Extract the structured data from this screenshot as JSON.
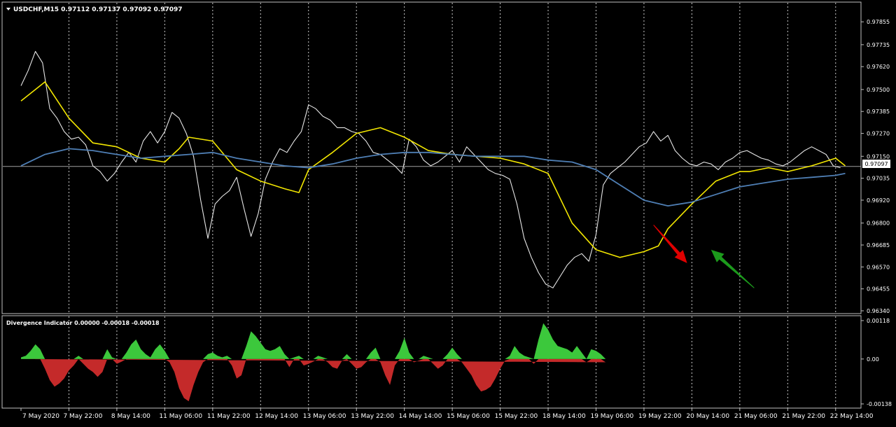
{
  "colors": {
    "background": "#000000",
    "frame": "#c0c0c0",
    "grid": "#c8c8c8",
    "price": "#e6e6e6",
    "ma_fast": "#f2e600",
    "ma_slow": "#4f7fb5",
    "bar_positive": "#3cc83c",
    "bar_negative": "#c42a2a",
    "arrow_down": "#e00000",
    "arrow_up": "#1c9a1c",
    "current_price_line": "#a0a0a0"
  },
  "main_chart": {
    "header": "USDCHF,M15  0.97112 0.97137 0.97092 0.97097",
    "current_price_label": "0.97097",
    "current_price": 0.97097
  },
  "indicator": {
    "header": "Divergence Indicator 0.00000 -0.00018 -0.00018"
  },
  "chart_data": [
    {
      "type": "line",
      "title": "USDCHF,M15",
      "ylim": [
        0.9634,
        0.9794
      ],
      "x_categories": [
        "7 May 2020",
        "7 May 22:00",
        "8 May 14:00",
        "11 May 06:00",
        "11 May 22:00",
        "12 May 14:00",
        "13 May 06:00",
        "13 May 22:00",
        "14 May 14:00",
        "15 May 06:00",
        "15 May 22:00",
        "18 May 14:00",
        "19 May 06:00",
        "19 May 22:00",
        "20 May 14:00",
        "21 May 06:00",
        "21 May 22:00",
        "22 May 14:00"
      ],
      "y_ticks": [
        "0.97855",
        "0.97735",
        "0.97620",
        "0.97500",
        "0.97385",
        "0.97270",
        "0.97150",
        "0.97035",
        "0.96920",
        "0.96800",
        "0.96685",
        "0.96570",
        "0.96455",
        "0.96340"
      ],
      "series": [
        {
          "style": "price",
          "x": [
            0,
            0.15,
            0.3,
            0.45,
            0.6,
            0.75,
            0.9,
            1.05,
            1.2,
            1.35,
            1.5,
            1.65,
            1.8,
            1.95,
            2.1,
            2.25,
            2.4,
            2.55,
            2.7,
            2.85,
            3.0,
            3.15,
            3.3,
            3.45,
            3.6,
            3.75,
            3.9,
            4.05,
            4.2,
            4.35,
            4.5,
            4.65,
            4.8,
            4.95,
            5.1,
            5.25,
            5.4,
            5.55,
            5.7,
            5.85,
            6.0,
            6.15,
            6.3,
            6.45,
            6.6,
            6.75,
            6.9,
            7.05,
            7.2,
            7.35,
            7.5,
            7.65,
            7.8,
            7.95,
            8.1,
            8.25,
            8.4,
            8.55,
            8.7,
            8.85,
            9.0,
            9.15,
            9.3,
            9.45,
            9.6,
            9.75,
            9.9,
            10.05,
            10.2,
            10.35,
            10.5,
            10.65,
            10.8,
            10.95,
            11.1,
            11.25,
            11.4,
            11.55,
            11.7,
            11.85,
            12.0,
            12.15,
            12.3,
            12.45,
            12.6,
            12.75,
            12.9,
            13.05,
            13.2,
            13.35,
            13.5,
            13.65,
            13.8,
            13.95,
            14.1,
            14.25,
            14.4,
            14.55,
            14.7,
            14.85,
            15.0,
            15.15,
            15.3,
            15.45,
            15.6,
            15.75,
            15.9,
            16.05,
            16.2,
            16.35,
            16.5,
            16.65,
            16.8,
            16.95,
            17.1
          ],
          "y": [
            0.9752,
            0.976,
            0.977,
            0.9764,
            0.974,
            0.9735,
            0.9728,
            0.9724,
            0.9725,
            0.9721,
            0.971,
            0.9707,
            0.9702,
            0.9706,
            0.9712,
            0.9717,
            0.9712,
            0.9723,
            0.9728,
            0.9722,
            0.9728,
            0.9738,
            0.9735,
            0.9727,
            0.9715,
            0.9692,
            0.9672,
            0.969,
            0.9694,
            0.9697,
            0.9704,
            0.9688,
            0.9673,
            0.9685,
            0.9703,
            0.9712,
            0.9719,
            0.9717,
            0.9723,
            0.9728,
            0.9742,
            0.974,
            0.9736,
            0.9734,
            0.973,
            0.973,
            0.9728,
            0.9727,
            0.9723,
            0.9717,
            0.9716,
            0.9713,
            0.971,
            0.9706,
            0.9724,
            0.972,
            0.9713,
            0.971,
            0.9712,
            0.9715,
            0.9718,
            0.9712,
            0.972,
            0.9716,
            0.9712,
            0.9708,
            0.9706,
            0.9705,
            0.9703,
            0.969,
            0.9672,
            0.9662,
            0.9654,
            0.9648,
            0.9646,
            0.9652,
            0.9658,
            0.9662,
            0.9664,
            0.966,
            0.9674,
            0.97,
            0.9706,
            0.9709,
            0.9712,
            0.9716,
            0.972,
            0.9722,
            0.9728,
            0.9723,
            0.9726,
            0.9718,
            0.9714,
            0.9711,
            0.971,
            0.9712,
            0.9711,
            0.9708,
            0.9712,
            0.9714,
            0.9717,
            0.9718,
            0.9716,
            0.9714,
            0.9713,
            0.9711,
            0.971,
            0.9712,
            0.9715,
            0.9718,
            0.972,
            0.9718,
            0.9716,
            0.971,
            0.9709
          ]
        },
        {
          "style": "ma_fast",
          "x": [
            0,
            0.5,
            1,
            1.5,
            2,
            2.5,
            3,
            3.3,
            3.5,
            4,
            4.5,
            5,
            5.5,
            5.8,
            6,
            6.5,
            7,
            7.5,
            8,
            8.5,
            9,
            9.5,
            10,
            10.5,
            11,
            11.5,
            12,
            12.5,
            13,
            13.3,
            13.5,
            14,
            14.5,
            15,
            15.2,
            15.6,
            16,
            16.5,
            17,
            17.2
          ],
          "y": [
            0.9744,
            0.9754,
            0.9735,
            0.9722,
            0.972,
            0.9714,
            0.9712,
            0.9719,
            0.9725,
            0.9723,
            0.9708,
            0.9702,
            0.9698,
            0.9696,
            0.9708,
            0.9717,
            0.9727,
            0.973,
            0.9725,
            0.9718,
            0.9716,
            0.9715,
            0.9714,
            0.9711,
            0.9706,
            0.968,
            0.9666,
            0.9662,
            0.9665,
            0.9668,
            0.9677,
            0.969,
            0.9702,
            0.9707,
            0.9707,
            0.9709,
            0.9707,
            0.971,
            0.9714,
            0.971
          ]
        },
        {
          "style": "ma_slow",
          "x": [
            0,
            0.5,
            1,
            1.5,
            2,
            2.5,
            3,
            3.5,
            4,
            4.5,
            5,
            5.5,
            6,
            6.5,
            7,
            7.5,
            8,
            8.5,
            9,
            9.5,
            10,
            10.5,
            11,
            11.5,
            12,
            12.5,
            13,
            13.5,
            14,
            14.5,
            15,
            15.5,
            16,
            16.5,
            17,
            17.2
          ],
          "y": [
            0.971,
            0.9716,
            0.9719,
            0.9718,
            0.9716,
            0.9714,
            0.9715,
            0.9716,
            0.9717,
            0.9714,
            0.9712,
            0.971,
            0.9709,
            0.9711,
            0.9714,
            0.9716,
            0.9717,
            0.9717,
            0.9716,
            0.9715,
            0.9715,
            0.9715,
            0.9713,
            0.9712,
            0.9708,
            0.97,
            0.9692,
            0.9689,
            0.9691,
            0.9695,
            0.9699,
            0.9701,
            0.9703,
            0.9704,
            0.9705,
            0.9706
          ]
        }
      ],
      "annotations": [
        {
          "type": "arrow",
          "direction": "down",
          "color": "red",
          "from": [
            13.2,
            0.9679
          ],
          "to": [
            13.9,
            0.9659
          ]
        },
        {
          "type": "arrow",
          "direction": "up",
          "color": "green",
          "from": [
            15.3,
            0.9646
          ],
          "to": [
            14.4,
            0.9666
          ]
        }
      ],
      "grid": true
    },
    {
      "type": "bar",
      "title": "Divergence Indicator",
      "ylim": [
        -0.00138,
        0.00118
      ],
      "y_ticks": [
        "0.00118",
        "0.00",
        "-0.00138"
      ],
      "x": [
        0,
        0.1,
        0.2,
        0.3,
        0.4,
        0.5,
        0.6,
        0.7,
        0.8,
        0.9,
        1.0,
        1.1,
        1.2,
        1.3,
        1.4,
        1.5,
        1.6,
        1.7,
        1.8,
        1.9,
        2.0,
        2.1,
        2.2,
        2.3,
        2.4,
        2.5,
        2.6,
        2.7,
        2.8,
        2.9,
        3.0,
        3.1,
        3.2,
        3.3,
        3.4,
        3.5,
        3.6,
        3.7,
        3.8,
        3.9,
        4.0,
        4.1,
        4.2,
        4.3,
        4.4,
        4.5,
        4.6,
        4.7,
        4.8,
        4.9,
        5.0,
        5.1,
        5.2,
        5.3,
        5.4,
        5.5,
        5.6,
        5.7,
        5.8,
        5.9,
        6.0,
        6.1,
        6.2,
        6.3,
        6.4,
        6.5,
        6.6,
        6.7,
        6.8,
        6.9,
        7.0,
        7.1,
        7.2,
        7.3,
        7.4,
        7.5,
        7.6,
        7.7,
        7.8,
        7.9,
        8.0,
        8.1,
        8.2,
        8.3,
        8.4,
        8.5,
        8.6,
        8.7,
        8.8,
        8.9,
        9.0,
        9.1,
        9.2,
        9.3,
        9.4,
        9.5,
        9.6,
        9.7,
        9.8,
        9.9,
        10.0,
        10.1,
        10.2,
        10.3,
        10.4,
        10.5,
        10.6,
        10.7,
        10.8,
        10.9,
        11.0,
        11.1,
        11.2,
        11.3,
        11.4,
        11.5,
        11.6,
        11.7,
        11.8,
        11.9,
        12.0,
        12.1,
        12.2,
        12.3,
        12.4,
        12.5,
        12.6,
        12.7,
        12.8,
        12.9,
        13.0,
        13.1,
        13.2,
        13.3,
        13.4,
        13.5,
        13.6,
        13.7,
        13.8,
        13.9,
        14.0,
        14.1,
        14.2,
        14.3,
        14.4,
        14.5,
        14.6,
        14.7,
        14.8,
        14.9,
        15.0,
        15.1,
        15.2,
        15.3,
        15.4,
        15.5,
        15.6,
        15.7,
        15.8,
        15.9,
        16.0,
        16.1,
        16.2,
        16.3,
        16.4,
        16.5,
        16.6,
        16.7,
        16.8,
        16.9,
        17.0,
        17.1
      ],
      "values": [
        5e-05,
        0.0001,
        0.00025,
        0.00045,
        0.0003,
        -0.0003,
        -0.00065,
        -0.00085,
        -0.00075,
        -0.0006,
        -0.00035,
        -0.0002,
        0.0001,
        -0.00015,
        -0.0003,
        -0.0004,
        -0.00055,
        -0.0004,
        0.0003,
        5e-05,
        -0.00015,
        -8e-05,
        0.0002,
        0.00045,
        0.0006,
        0.0003,
        0.00015,
        5e-05,
        0.0003,
        0.00045,
        0.00025,
        -0.0001,
        -0.0004,
        -0.0009,
        -0.0012,
        -0.0013,
        -0.0008,
        -0.0004,
        -0.0001,
        0.00015,
        0.0002,
        0.0001,
        5e-05,
        0.0001,
        -0.0002,
        -0.0006,
        -0.0005,
        0.0004,
        0.00085,
        0.0007,
        0.0005,
        0.0003,
        0.00025,
        0.0003,
        0.0004,
        0.00015,
        -0.00025,
        5e-05,
        0.0001,
        -0.0002,
        -0.00015,
        -8e-05,
        0.0001,
        5e-05,
        -0.0001,
        -0.00025,
        -0.0003,
        -5e-05,
        0.00015,
        -0.00015,
        -0.0003,
        -0.00025,
        -0.0001,
        0.0002,
        0.00035,
        -0.0001,
        -0.0005,
        -0.0008,
        -0.0002,
        0.00025,
        0.00065,
        0.0002,
        -0.0001,
        -5e-05,
        0.0001,
        5e-05,
        -0.00015,
        -0.0003,
        -0.0002,
        0.00015,
        0.00035,
        0.00015,
        -0.0001,
        -0.0003,
        -0.0005,
        -0.0008,
        -0.001,
        -0.00095,
        -0.00085,
        -0.0006,
        -0.0003,
        -5e-05,
        0.0001,
        0.0004,
        0.0002,
        0.0001,
        5e-05,
        -0.00015,
        0.0006,
        0.0011,
        0.0009,
        0.0006,
        0.0004,
        0.00035,
        0.0003,
        0.0002,
        0.0004,
        0.0002,
        -0.0001,
        0.0003,
        0.00025,
        0.00015,
        -0.0001
      ]
    }
  ]
}
